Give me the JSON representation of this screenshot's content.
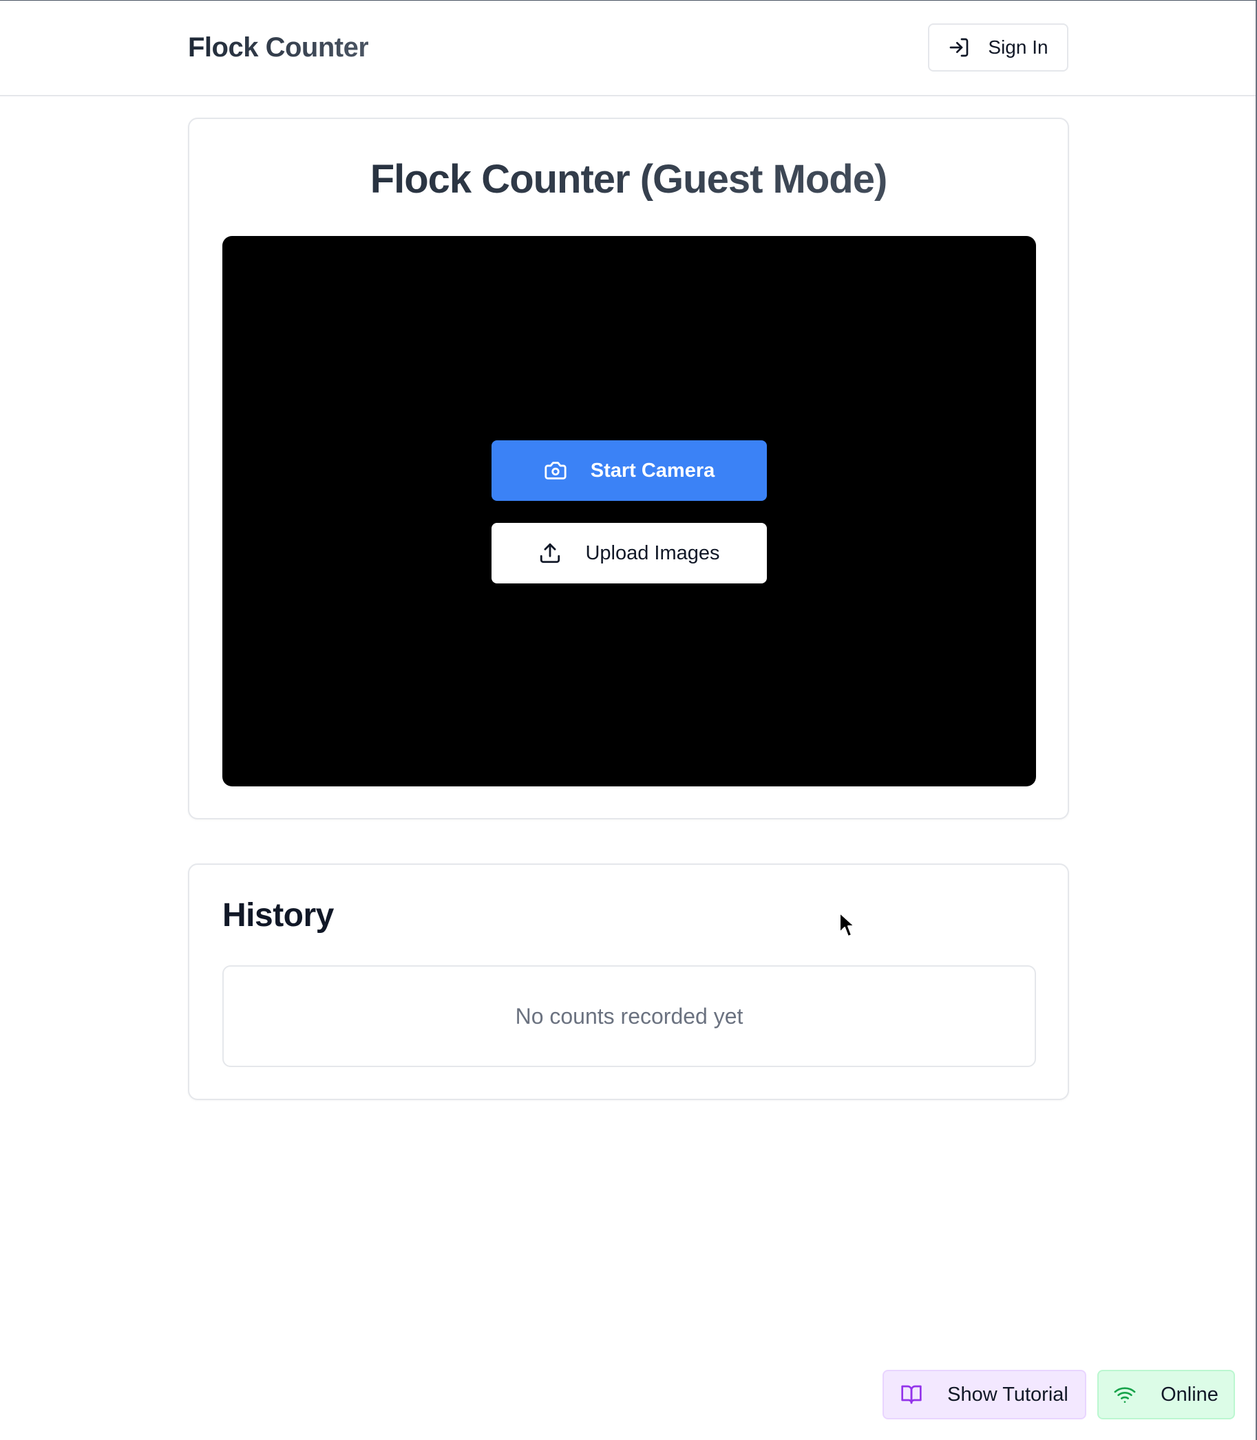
{
  "header": {
    "brand": "Flock Counter",
    "sign_in_label": "Sign In",
    "sign_in_icon": "log-in-icon"
  },
  "main": {
    "title": "Flock Counter (Guest Mode)",
    "start_camera_label": "Start Camera",
    "start_camera_icon": "camera-icon",
    "upload_images_label": "Upload Images",
    "upload_images_icon": "upload-icon"
  },
  "history": {
    "title": "History",
    "empty_text": "No counts recorded yet"
  },
  "footer": {
    "tutorial_label": "Show Tutorial",
    "tutorial_icon": "book-open-icon",
    "status_label": "Online",
    "status_icon": "wifi-icon"
  },
  "colors": {
    "primary": "#3b82f6",
    "tutorial_bg": "#f3e8ff",
    "tutorial_accent": "#9333ea",
    "online_bg": "#dcfce7",
    "online_accent": "#16a34a"
  }
}
